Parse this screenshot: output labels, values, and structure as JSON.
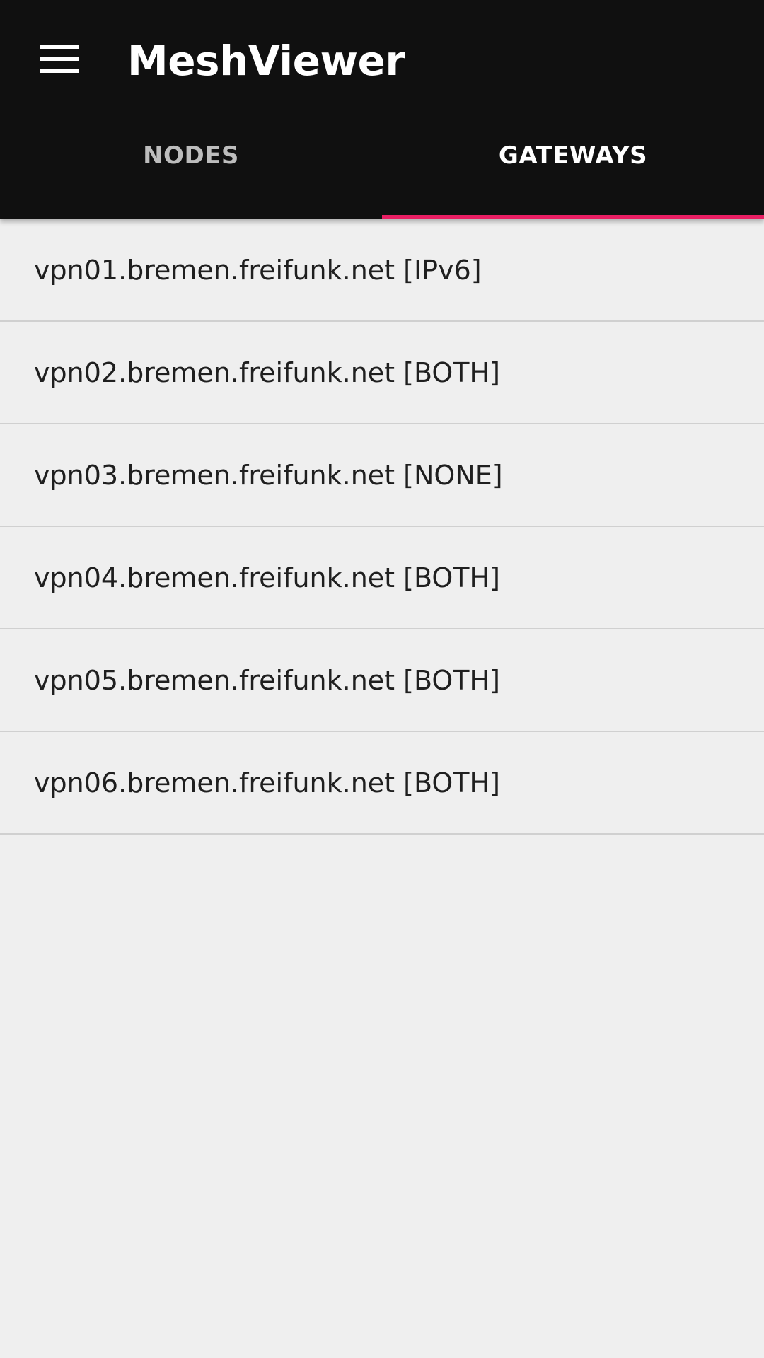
{
  "app": {
    "title": "MeshViewer",
    "menu_icon": "hamburger-menu-icon"
  },
  "tabs": [
    {
      "label": "NODES",
      "active": false
    },
    {
      "label": "GATEWAYS",
      "active": true
    }
  ],
  "colors": {
    "appbar": "#101010",
    "accent": "#e91e63",
    "background": "#efefef"
  },
  "gateways": [
    {
      "label": "vpn01.bremen.freifunk.net [IPv6]"
    },
    {
      "label": "vpn02.bremen.freifunk.net [BOTH]"
    },
    {
      "label": "vpn03.bremen.freifunk.net [NONE]"
    },
    {
      "label": "vpn04.bremen.freifunk.net [BOTH]"
    },
    {
      "label": "vpn05.bremen.freifunk.net [BOTH]"
    },
    {
      "label": "vpn06.bremen.freifunk.net [BOTH]"
    }
  ]
}
